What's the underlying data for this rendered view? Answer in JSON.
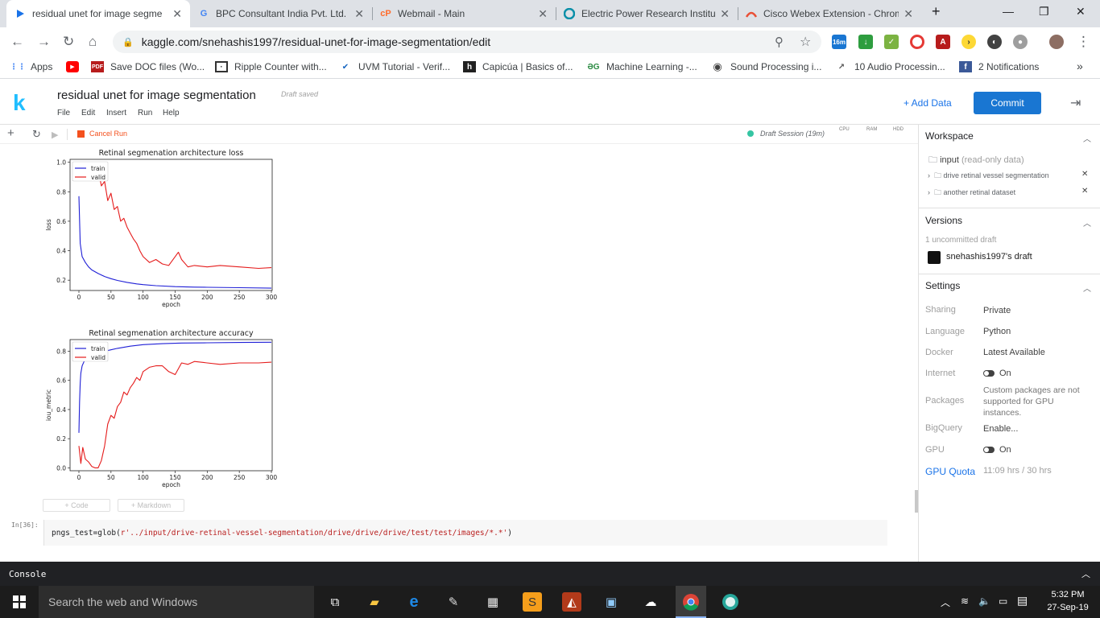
{
  "browser": {
    "tabs": [
      {
        "title": "residual unet for image segme",
        "icon": "kaggle-play-icon",
        "active": true
      },
      {
        "title": "BPC Consultant India Pvt. Ltd.",
        "icon": "google-icon"
      },
      {
        "title": "Webmail - Main",
        "icon": "cpanel-icon"
      },
      {
        "title": "Electric Power Research Institut",
        "icon": "epri-icon"
      },
      {
        "title": "Cisco Webex Extension - Chrom",
        "icon": "webex-icon"
      }
    ],
    "new_tab": "+",
    "url": "kaggle.com/snehashis1997/residual-unet-for-image-segmentation/edit",
    "extension_badge": "16m",
    "bookmarks": [
      {
        "label": "Apps",
        "icon": "apps-grid-icon"
      },
      {
        "label": "",
        "icon": "youtube-icon"
      },
      {
        "label": "Save DOC files (Wo...",
        "icon": "pdf-icon"
      },
      {
        "label": "Ripple Counter with...",
        "icon": "chip-icon"
      },
      {
        "label": "UVM Tutorial - Verif...",
        "icon": "uvm-icon"
      },
      {
        "label": "Capicúa | Basics of...",
        "icon": "h-icon"
      },
      {
        "label": "Machine Learning -...",
        "icon": "gfg-icon"
      },
      {
        "label": "Sound Processing i...",
        "icon": "globe-icon"
      },
      {
        "label": "10 Audio Processin...",
        "icon": "chart-line-icon"
      },
      {
        "label": "2 Notifications",
        "icon": "facebook-icon"
      }
    ]
  },
  "kaggle": {
    "logo": "k",
    "title": "residual unet for image segmentation",
    "draft_status": "Draft saved",
    "menu": [
      "File",
      "Edit",
      "Insert",
      "Run",
      "Help"
    ],
    "add_data": "+ Add Data",
    "commit": "Commit",
    "cancel_run": "Cancel Run",
    "session": "Draft Session (19m)",
    "meters": [
      "CPU",
      "RAM",
      "HDD"
    ]
  },
  "notebook": {
    "add_code": "+ Code",
    "add_markdown": "+ Markdown",
    "in_prompt": "In[36]:",
    "code_prefix": "pngs_test=glob(",
    "code_string": "r'../input/drive-retinal-vessel-segmentation/drive/drive/drive/test/test/images/*.*'",
    "code_suffix": ")"
  },
  "sidebar": {
    "workspace": {
      "header": "Workspace",
      "input_label": "input",
      "input_note": "(read-only data)",
      "datasets": [
        "drive retinal vessel segmentation",
        "another retinal dataset"
      ]
    },
    "versions": {
      "header": "Versions",
      "uncommitted": "1 uncommitted draft",
      "draft_name": "snehashis1997's draft"
    },
    "settings": {
      "header": "Settings",
      "rows": [
        {
          "label": "Sharing",
          "value": "Private"
        },
        {
          "label": "Language",
          "value": "Python"
        },
        {
          "label": "Docker",
          "value": "Latest Available"
        },
        {
          "label": "Internet",
          "value": "On"
        },
        {
          "label": "Packages",
          "value": "Custom packages are not supported for GPU instances."
        },
        {
          "label": "BigQuery",
          "value": "Enable..."
        },
        {
          "label": "GPU",
          "value": "On"
        },
        {
          "label": "GPU Quota",
          "value": "11:09 hrs / 30 hrs"
        }
      ]
    }
  },
  "console": {
    "label": "Console"
  },
  "taskbar": {
    "search_placeholder": "Search the web and Windows",
    "time": "5:32 PM",
    "date": "27-Sep-19"
  },
  "colors": {
    "train": "#1f1fd6",
    "valid": "#e51b1b",
    "kaggle_blue": "#20beff",
    "commit_blue": "#1976d2"
  },
  "chart_data": [
    {
      "type": "line",
      "title": "Retinal segmenation architecture loss",
      "xlabel": "epoch",
      "ylabel": "loss",
      "xlim": [
        0,
        300
      ],
      "ylim": [
        0.13,
        1.02
      ],
      "xticks": [
        0,
        50,
        100,
        150,
        200,
        250,
        300
      ],
      "yticks": [
        0.2,
        0.4,
        0.6,
        0.8,
        1.0
      ],
      "legend": "upper-left",
      "series": [
        {
          "name": "train",
          "x": [
            0,
            2,
            5,
            10,
            15,
            20,
            30,
            40,
            50,
            60,
            75,
            90,
            100,
            120,
            150,
            180,
            200,
            250,
            300
          ],
          "y": [
            0.77,
            0.45,
            0.36,
            0.32,
            0.29,
            0.27,
            0.245,
            0.225,
            0.21,
            0.198,
            0.185,
            0.175,
            0.17,
            0.163,
            0.156,
            0.153,
            0.152,
            0.149,
            0.146
          ]
        },
        {
          "name": "valid",
          "x": [
            0,
            5,
            10,
            15,
            20,
            25,
            30,
            35,
            40,
            45,
            50,
            55,
            60,
            65,
            70,
            75,
            80,
            85,
            90,
            95,
            100,
            110,
            120,
            130,
            140,
            150,
            155,
            160,
            170,
            180,
            200,
            220,
            250,
            280,
            300
          ],
          "y": [
            0.99,
            0.88,
            1.0,
            0.92,
            0.97,
            0.93,
            0.95,
            0.84,
            0.87,
            0.74,
            0.79,
            0.68,
            0.7,
            0.6,
            0.62,
            0.56,
            0.52,
            0.48,
            0.45,
            0.4,
            0.36,
            0.32,
            0.34,
            0.31,
            0.3,
            0.36,
            0.39,
            0.34,
            0.29,
            0.3,
            0.29,
            0.3,
            0.29,
            0.28,
            0.285
          ]
        }
      ]
    },
    {
      "type": "line",
      "title": "Retinal segmenation architecture accuracy",
      "xlabel": "epoch",
      "ylabel": "iou_metric",
      "xlim": [
        0,
        300
      ],
      "ylim": [
        -0.02,
        0.88
      ],
      "xticks": [
        0,
        50,
        100,
        150,
        200,
        250,
        300
      ],
      "yticks": [
        0.0,
        0.2,
        0.4,
        0.6,
        0.8
      ],
      "legend": "upper-left",
      "series": [
        {
          "name": "train",
          "x": [
            0,
            1,
            2,
            3,
            5,
            8,
            12,
            20,
            30,
            40,
            50,
            60,
            80,
            100,
            130,
            160,
            200,
            250,
            300
          ],
          "y": [
            0.24,
            0.45,
            0.58,
            0.65,
            0.7,
            0.73,
            0.75,
            0.77,
            0.79,
            0.8,
            0.81,
            0.82,
            0.835,
            0.845,
            0.852,
            0.856,
            0.858,
            0.86,
            0.862
          ]
        },
        {
          "name": "valid",
          "x": [
            0,
            3,
            6,
            10,
            15,
            20,
            25,
            30,
            35,
            40,
            45,
            50,
            55,
            60,
            65,
            70,
            75,
            80,
            85,
            90,
            95,
            100,
            110,
            120,
            130,
            140,
            150,
            160,
            170,
            180,
            200,
            220,
            250,
            280,
            300
          ],
          "y": [
            0.15,
            0.03,
            0.14,
            0.06,
            0.04,
            0.01,
            0.0,
            0.0,
            0.05,
            0.15,
            0.3,
            0.36,
            0.34,
            0.42,
            0.45,
            0.52,
            0.5,
            0.55,
            0.58,
            0.62,
            0.6,
            0.66,
            0.69,
            0.7,
            0.7,
            0.66,
            0.64,
            0.72,
            0.71,
            0.73,
            0.72,
            0.71,
            0.72,
            0.72,
            0.725
          ]
        }
      ]
    }
  ]
}
